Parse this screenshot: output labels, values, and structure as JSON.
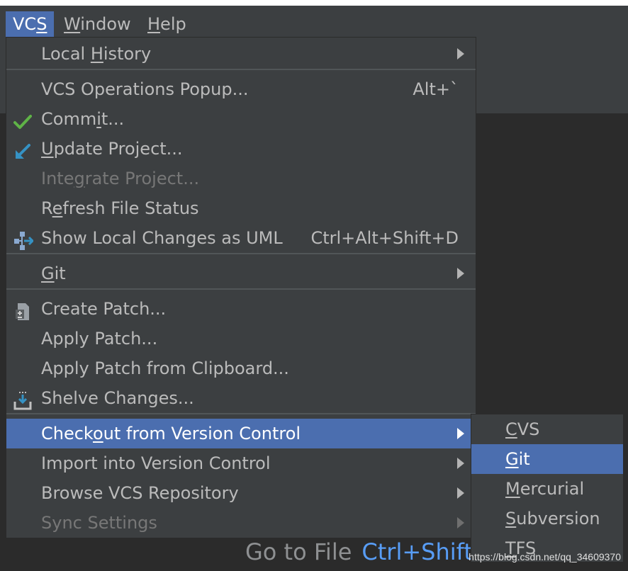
{
  "menubar": {
    "vcs": {
      "pre": "VC",
      "mnemonic": "S",
      "post": ""
    },
    "window": {
      "pre": "",
      "mnemonic": "W",
      "post": "indow"
    },
    "help": {
      "pre": "",
      "mnemonic": "H",
      "post": "elp"
    }
  },
  "menu": {
    "local_history": {
      "pre": "Local ",
      "mnemonic": "H",
      "post": "istory"
    },
    "vcs_operations_popup": {
      "label": "VCS Operations Popup...",
      "shortcut": "Alt+`"
    },
    "commit": {
      "pre": "Comm",
      "mnemonic": "i",
      "post": "t..."
    },
    "update_project": {
      "pre": "",
      "mnemonic": "U",
      "post": "pdate Project..."
    },
    "integrate_project": {
      "pre": "Inte",
      "mnemonic": "g",
      "post": "rate Project..."
    },
    "refresh_file_status": {
      "pre": "R",
      "mnemonic": "e",
      "post": "fresh File Status"
    },
    "show_local_changes_uml": {
      "label": "Show Local Changes as UML",
      "shortcut": "Ctrl+Alt+Shift+D"
    },
    "git": {
      "pre": "",
      "mnemonic": "G",
      "post": "it"
    },
    "create_patch": {
      "label": "Create Patch..."
    },
    "apply_patch": {
      "label": "Apply Patch..."
    },
    "apply_patch_clipboard": {
      "label": "Apply Patch from Clipboard..."
    },
    "shelve_changes": {
      "label": "Shelve Changes..."
    },
    "checkout": {
      "pre": "Check",
      "mnemonic": "o",
      "post": "ut from Version Control"
    },
    "import_vc": {
      "label": "Import into Version Control"
    },
    "browse_repo": {
      "label": "Browse VCS Repository"
    },
    "sync_settings": {
      "label": "Sync Settings"
    }
  },
  "submenu": {
    "cvs": {
      "pre": "",
      "mnemonic": "C",
      "post": "VS"
    },
    "git": {
      "pre": "",
      "mnemonic": "G",
      "post": "it"
    },
    "mercurial": {
      "pre": "",
      "mnemonic": "M",
      "post": "ercurial"
    },
    "subversion": {
      "pre": "",
      "mnemonic": "S",
      "post": "ubversion"
    },
    "tfs": {
      "pre": "",
      "mnemonic": "T",
      "post": "FS"
    }
  },
  "hint": {
    "text": "Go to File",
    "shortcut": "Ctrl+Shift"
  },
  "watermark": "https://blog.csdn.net/qq_34609370",
  "colors": {
    "selection": "#4b6eaf",
    "menu_bg": "#3c3f41",
    "commit_check": "#5fb347",
    "update_arrow": "#3592c4",
    "hint_shortcut": "#589df6"
  },
  "icons": {
    "commit": "check-icon",
    "update": "update-arrow-icon",
    "uml": "uml-diagram-icon",
    "patch": "patch-file-icon",
    "shelve": "shelve-icon"
  }
}
